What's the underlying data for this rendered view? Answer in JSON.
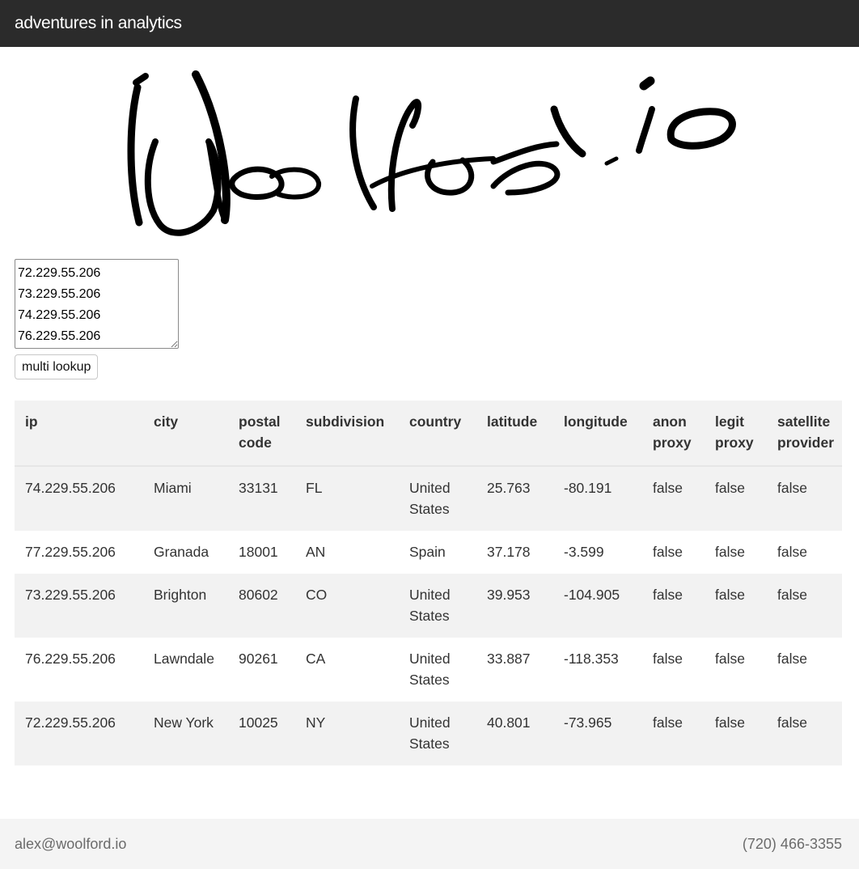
{
  "header": {
    "brand": "adventures in analytics"
  },
  "logo": {
    "text": "Woolford.io",
    "icon": "handwritten-signature-logo",
    "color": "#000000"
  },
  "lookup": {
    "ip_list": "72.229.55.206\n73.229.55.206\n74.229.55.206\n76.229.55.206",
    "button_label": "multi lookup"
  },
  "table": {
    "headers": [
      "ip",
      "city",
      "postal code",
      "subdivision",
      "country",
      "latitude",
      "longitude",
      "anon proxy",
      "legit proxy",
      "satellite provider"
    ],
    "rows": [
      [
        "74.229.55.206",
        "Miami",
        "33131",
        "FL",
        "United States",
        "25.763",
        "-80.191",
        "false",
        "false",
        "false"
      ],
      [
        "77.229.55.206",
        "Granada",
        "18001",
        "AN",
        "Spain",
        "37.178",
        "-3.599",
        "false",
        "false",
        "false"
      ],
      [
        "73.229.55.206",
        "Brighton",
        "80602",
        "CO",
        "United States",
        "39.953",
        "-104.905",
        "false",
        "false",
        "false"
      ],
      [
        "76.229.55.206",
        "Lawndale",
        "90261",
        "CA",
        "United States",
        "33.887",
        "-118.353",
        "false",
        "false",
        "false"
      ],
      [
        "72.229.55.206",
        "New York",
        "10025",
        "NY",
        "United States",
        "40.801",
        "-73.965",
        "false",
        "false",
        "false"
      ]
    ]
  },
  "footer": {
    "email": "alex@woolford.io",
    "phone": "(720) 466-3355"
  },
  "colors": {
    "topbar": "#2b2b2b",
    "stripe": "#f2f2f2",
    "footer_bg": "#f4f4f4"
  }
}
